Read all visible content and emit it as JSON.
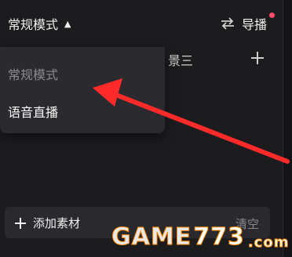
{
  "header": {
    "mode_label": "常规模式",
    "guide_label": "导播"
  },
  "scene": {
    "tab_label": "景三"
  },
  "dropdown": {
    "items": [
      {
        "label": "常规模式",
        "state": "muted"
      },
      {
        "label": "语音直播",
        "state": "active"
      }
    ]
  },
  "bottom_bar": {
    "add_label": "添加素材",
    "clear_label": "清空"
  },
  "watermark": {
    "main": "GAME",
    "num": "773",
    "dotcom": ".com"
  },
  "colors": {
    "background": "#141416",
    "panel": "#1c1c1f",
    "dropdown": "#2b2b2f",
    "accent_red": "#ff4d6a",
    "arrow": "#ff2a2a",
    "watermark_stroke": "#ff8a00"
  }
}
